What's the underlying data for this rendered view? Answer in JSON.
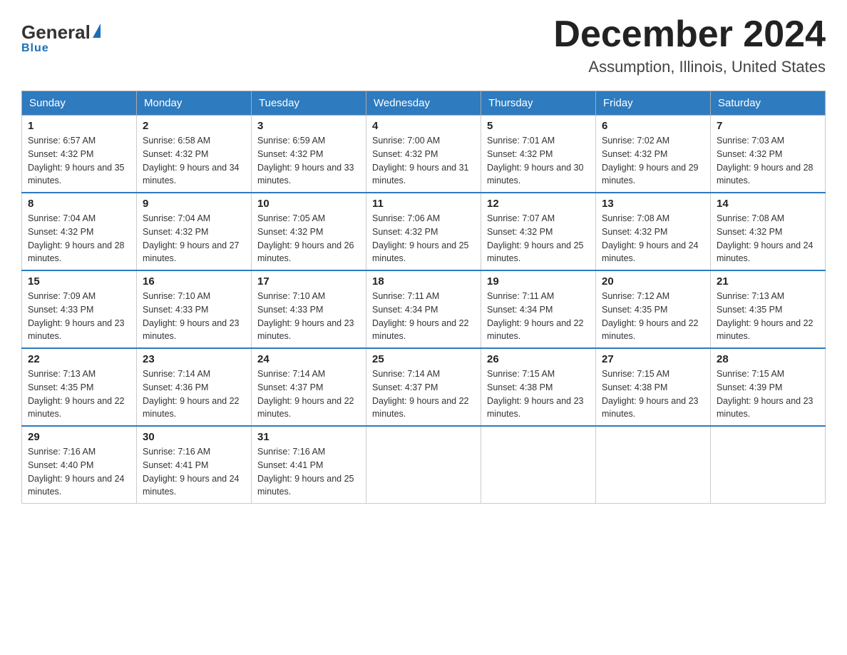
{
  "header": {
    "logo_general": "General",
    "logo_blue": "Blue",
    "month_title": "December 2024",
    "location": "Assumption, Illinois, United States"
  },
  "weekdays": [
    "Sunday",
    "Monday",
    "Tuesday",
    "Wednesday",
    "Thursday",
    "Friday",
    "Saturday"
  ],
  "weeks": [
    [
      {
        "day": "1",
        "sunrise": "6:57 AM",
        "sunset": "4:32 PM",
        "daylight": "9 hours and 35 minutes."
      },
      {
        "day": "2",
        "sunrise": "6:58 AM",
        "sunset": "4:32 PM",
        "daylight": "9 hours and 34 minutes."
      },
      {
        "day": "3",
        "sunrise": "6:59 AM",
        "sunset": "4:32 PM",
        "daylight": "9 hours and 33 minutes."
      },
      {
        "day": "4",
        "sunrise": "7:00 AM",
        "sunset": "4:32 PM",
        "daylight": "9 hours and 31 minutes."
      },
      {
        "day": "5",
        "sunrise": "7:01 AM",
        "sunset": "4:32 PM",
        "daylight": "9 hours and 30 minutes."
      },
      {
        "day": "6",
        "sunrise": "7:02 AM",
        "sunset": "4:32 PM",
        "daylight": "9 hours and 29 minutes."
      },
      {
        "day": "7",
        "sunrise": "7:03 AM",
        "sunset": "4:32 PM",
        "daylight": "9 hours and 28 minutes."
      }
    ],
    [
      {
        "day": "8",
        "sunrise": "7:04 AM",
        "sunset": "4:32 PM",
        "daylight": "9 hours and 28 minutes."
      },
      {
        "day": "9",
        "sunrise": "7:04 AM",
        "sunset": "4:32 PM",
        "daylight": "9 hours and 27 minutes."
      },
      {
        "day": "10",
        "sunrise": "7:05 AM",
        "sunset": "4:32 PM",
        "daylight": "9 hours and 26 minutes."
      },
      {
        "day": "11",
        "sunrise": "7:06 AM",
        "sunset": "4:32 PM",
        "daylight": "9 hours and 25 minutes."
      },
      {
        "day": "12",
        "sunrise": "7:07 AM",
        "sunset": "4:32 PM",
        "daylight": "9 hours and 25 minutes."
      },
      {
        "day": "13",
        "sunrise": "7:08 AM",
        "sunset": "4:32 PM",
        "daylight": "9 hours and 24 minutes."
      },
      {
        "day": "14",
        "sunrise": "7:08 AM",
        "sunset": "4:32 PM",
        "daylight": "9 hours and 24 minutes."
      }
    ],
    [
      {
        "day": "15",
        "sunrise": "7:09 AM",
        "sunset": "4:33 PM",
        "daylight": "9 hours and 23 minutes."
      },
      {
        "day": "16",
        "sunrise": "7:10 AM",
        "sunset": "4:33 PM",
        "daylight": "9 hours and 23 minutes."
      },
      {
        "day": "17",
        "sunrise": "7:10 AM",
        "sunset": "4:33 PM",
        "daylight": "9 hours and 23 minutes."
      },
      {
        "day": "18",
        "sunrise": "7:11 AM",
        "sunset": "4:34 PM",
        "daylight": "9 hours and 22 minutes."
      },
      {
        "day": "19",
        "sunrise": "7:11 AM",
        "sunset": "4:34 PM",
        "daylight": "9 hours and 22 minutes."
      },
      {
        "day": "20",
        "sunrise": "7:12 AM",
        "sunset": "4:35 PM",
        "daylight": "9 hours and 22 minutes."
      },
      {
        "day": "21",
        "sunrise": "7:13 AM",
        "sunset": "4:35 PM",
        "daylight": "9 hours and 22 minutes."
      }
    ],
    [
      {
        "day": "22",
        "sunrise": "7:13 AM",
        "sunset": "4:35 PM",
        "daylight": "9 hours and 22 minutes."
      },
      {
        "day": "23",
        "sunrise": "7:14 AM",
        "sunset": "4:36 PM",
        "daylight": "9 hours and 22 minutes."
      },
      {
        "day": "24",
        "sunrise": "7:14 AM",
        "sunset": "4:37 PM",
        "daylight": "9 hours and 22 minutes."
      },
      {
        "day": "25",
        "sunrise": "7:14 AM",
        "sunset": "4:37 PM",
        "daylight": "9 hours and 22 minutes."
      },
      {
        "day": "26",
        "sunrise": "7:15 AM",
        "sunset": "4:38 PM",
        "daylight": "9 hours and 23 minutes."
      },
      {
        "day": "27",
        "sunrise": "7:15 AM",
        "sunset": "4:38 PM",
        "daylight": "9 hours and 23 minutes."
      },
      {
        "day": "28",
        "sunrise": "7:15 AM",
        "sunset": "4:39 PM",
        "daylight": "9 hours and 23 minutes."
      }
    ],
    [
      {
        "day": "29",
        "sunrise": "7:16 AM",
        "sunset": "4:40 PM",
        "daylight": "9 hours and 24 minutes."
      },
      {
        "day": "30",
        "sunrise": "7:16 AM",
        "sunset": "4:41 PM",
        "daylight": "9 hours and 24 minutes."
      },
      {
        "day": "31",
        "sunrise": "7:16 AM",
        "sunset": "4:41 PM",
        "daylight": "9 hours and 25 minutes."
      },
      {
        "day": "",
        "sunrise": "",
        "sunset": "",
        "daylight": ""
      },
      {
        "day": "",
        "sunrise": "",
        "sunset": "",
        "daylight": ""
      },
      {
        "day": "",
        "sunrise": "",
        "sunset": "",
        "daylight": ""
      },
      {
        "day": "",
        "sunrise": "",
        "sunset": "",
        "daylight": ""
      }
    ]
  ],
  "labels": {
    "sunrise_prefix": "Sunrise: ",
    "sunset_prefix": "Sunset: ",
    "daylight_prefix": "Daylight: "
  }
}
